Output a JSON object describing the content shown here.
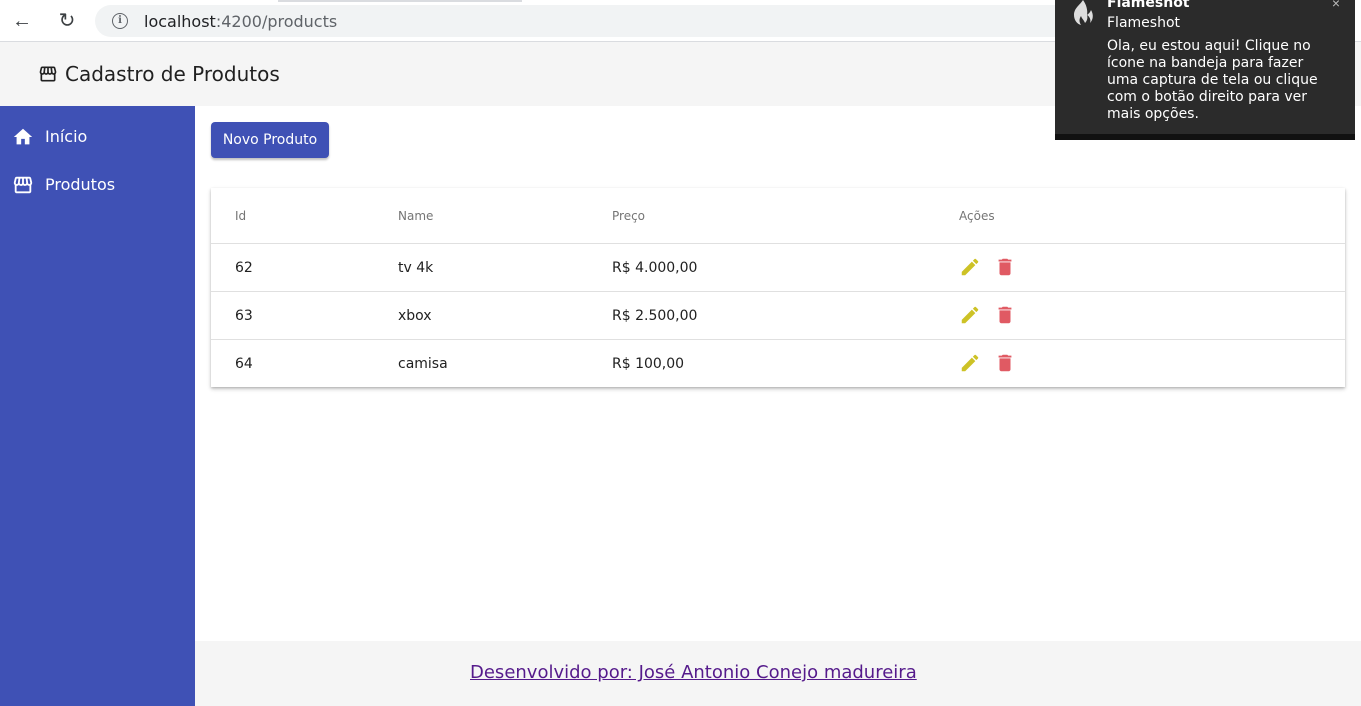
{
  "browser": {
    "url_host": "localhost",
    "url_path": ":4200/products"
  },
  "toolbar": {
    "title": "Cadastro de Produtos"
  },
  "sidebar": {
    "items": [
      {
        "label": "Início",
        "icon": "home-icon"
      },
      {
        "label": "Produtos",
        "icon": "store-icon"
      }
    ]
  },
  "main": {
    "new_button_label": "Novo Produto",
    "table": {
      "headers": [
        "Id",
        "Name",
        "Preço",
        "Ações"
      ],
      "rows": [
        {
          "id": "62",
          "name": "tv 4k",
          "price": "R$ 4.000,00"
        },
        {
          "id": "63",
          "name": "xbox",
          "price": "R$ 2.500,00"
        },
        {
          "id": "64",
          "name": "camisa",
          "price": "R$ 100,00"
        }
      ]
    }
  },
  "footer": {
    "credit": "Desenvolvido por: José Antonio Conejo madureira"
  },
  "notification": {
    "app_name": "Flameshot",
    "title": "Flameshot",
    "body": "Ola, eu estou aqui! Clique no ícone na bandeja para fazer uma captura de tela ou clique com o botão direito para ver mais opções.",
    "close": "×"
  },
  "colors": {
    "primary": "#3f51b5",
    "edit": "#cdc226",
    "delete": "#e05a63",
    "toolbar_bg": "#f5f5f5"
  }
}
